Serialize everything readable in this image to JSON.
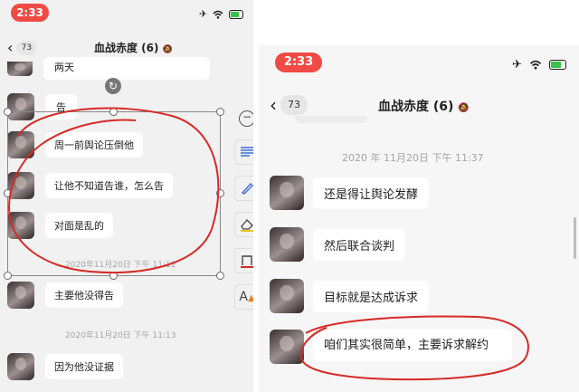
{
  "left": {
    "status_time": "2:33",
    "header": {
      "back_count": "73",
      "title": "血战赤度 (6)"
    },
    "messages": [
      {
        "text": "两天"
      },
      {
        "text": "告"
      },
      {
        "text": "周一前舆论压倒他"
      },
      {
        "text": "让他不知道告谁，怎么告"
      },
      {
        "text": "对面是乱的"
      },
      {
        "text": "主要他没得告"
      },
      {
        "text": "因为他没证据"
      }
    ],
    "timestamps": [
      "2020年11月20日 下午 11:12",
      "2020年11月20日 下午 11:13"
    ]
  },
  "right": {
    "status_time": "2:33",
    "header": {
      "back_count": "73",
      "title": "血战赤度 (6)"
    },
    "timestamp": "2020 年 11月20日 下午 11:37",
    "messages": [
      {
        "text": "还是得让舆论发酵"
      },
      {
        "text": "然后联合谈判"
      },
      {
        "text": "目标就是达成诉求"
      },
      {
        "text": "咱们其实很简单，主要诉求解约"
      }
    ]
  },
  "icons": {
    "airplane": "airplane-icon",
    "wifi": "wifi-icon",
    "battery": "battery-icon",
    "mute": "bell-mute-icon"
  },
  "colors": {
    "status_pill": "#f04a45",
    "annotation": "#d62a26",
    "battery_fill": "#36c24b"
  }
}
